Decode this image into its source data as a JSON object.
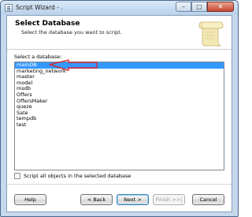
{
  "window": {
    "title": "Script Wizard - .",
    "minimize_glyph": "–",
    "maximize_glyph": "□",
    "close_glyph": "✕"
  },
  "header": {
    "title": "Select Database",
    "subtitle": "Select the database you want to script."
  },
  "database_list": {
    "label": "Select a database:",
    "selected": "mainDB",
    "items": [
      "mainDB",
      "marketing_network",
      "master",
      "model",
      "msdb",
      "Offers",
      "OffersMaker",
      "queze",
      "Sate",
      "tempdb",
      "test"
    ]
  },
  "script_all_checkbox": {
    "label": "Script all objects in the selected database",
    "checked": false
  },
  "buttons": {
    "help": "Help",
    "back": "< Back",
    "next": "Next >",
    "finish": "Finish >>|",
    "cancel": "Cancel"
  },
  "colors": {
    "selection": "#3399ff",
    "annotation_arrow": "#d9262e"
  }
}
